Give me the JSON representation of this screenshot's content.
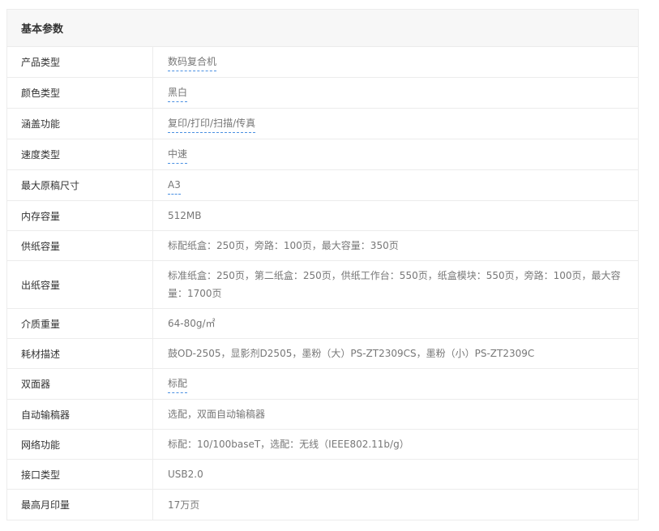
{
  "section": {
    "title": "基本参数"
  },
  "rows": [
    {
      "label": "产品类型",
      "value": "数码复合机",
      "linked": true
    },
    {
      "label": "颜色类型",
      "value": "黑白",
      "linked": true
    },
    {
      "label": "涵盖功能",
      "value": "复印/打印/扫描/传真",
      "linked": true
    },
    {
      "label": "速度类型",
      "value": "中速",
      "linked": true
    },
    {
      "label": "最大原稿尺寸",
      "value": "A3",
      "linked": true
    },
    {
      "label": "内存容量",
      "value": "512MB",
      "linked": false
    },
    {
      "label": "供纸容量",
      "value": "标配纸盒：250页，旁路：100页，最大容量：350页",
      "linked": false
    },
    {
      "label": "出纸容量",
      "value": "标准纸盒：250页，第二纸盒：250页，供纸工作台：550页，纸盒模块：550页，旁路：100页，最大容量：1700页",
      "linked": false
    },
    {
      "label": "介质重量",
      "value": "64-80g/㎡",
      "linked": false
    },
    {
      "label": "耗材描述",
      "value": "鼓OD-2505，显影剂D2505，墨粉（大）PS-ZT2309CS，墨粉（小）PS-ZT2309C",
      "linked": false
    },
    {
      "label": "双面器",
      "value": "标配",
      "linked": true
    },
    {
      "label": "自动输稿器",
      "value": "选配，双面自动输稿器",
      "linked": false
    },
    {
      "label": "网络功能",
      "value": "标配：10/100baseT，选配：无线（IEEE802.11b/g）",
      "linked": false
    },
    {
      "label": "接口类型",
      "value": "USB2.0",
      "linked": false
    },
    {
      "label": "最高月印量",
      "value": "17万页",
      "linked": false
    }
  ]
}
